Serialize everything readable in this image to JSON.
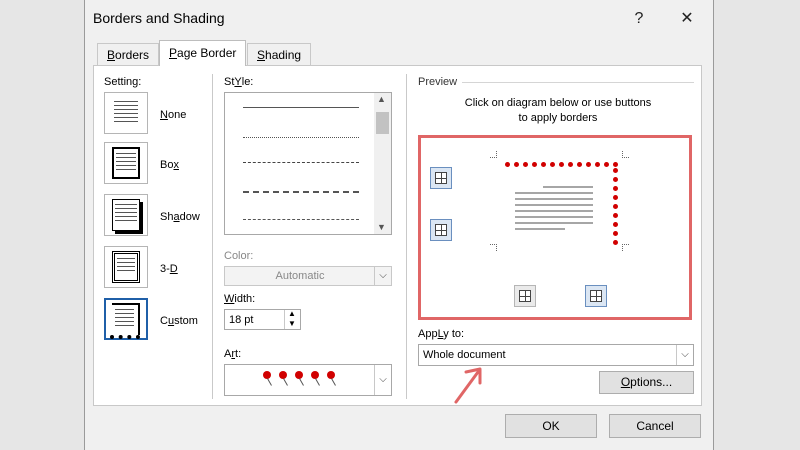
{
  "dialog": {
    "title": "Borders and Shading",
    "help": "?",
    "close": "✕"
  },
  "tabs": [
    {
      "label": "Borders",
      "mnemonic": "B",
      "rest": "orders"
    },
    {
      "label": "Page Border",
      "mnemonic": "P",
      "rest": "age Border"
    },
    {
      "label": "Shading",
      "mnemonic": "S",
      "rest": "hading"
    }
  ],
  "setting": {
    "label": "Setting:",
    "options": [
      {
        "mn": "N",
        "rest": "one"
      },
      {
        "mn": "x",
        "pre": "Bo"
      },
      {
        "mn": "a",
        "pre": "Sh",
        "rest": "dow"
      },
      {
        "pre": "3-",
        "mn": "D"
      },
      {
        "mn": "u",
        "pre": "C",
        "rest": "stom"
      }
    ]
  },
  "style": {
    "label_mn": "Y",
    "label_pre": "St",
    "label_rest": "le:"
  },
  "color": {
    "label": "Color:",
    "value": "Automatic"
  },
  "width": {
    "label_mn": "W",
    "label_rest": "idth:",
    "value": "18 pt"
  },
  "art": {
    "label_pre": "A",
    "label_mn": "r",
    "label_rest": "t:"
  },
  "preview": {
    "label": "Preview",
    "instruction_line1": "Click on diagram below or use buttons",
    "instruction_line2": "to apply borders"
  },
  "apply_to": {
    "label_mn": "L",
    "label_pre": "App",
    "label_rest": "y to:",
    "value": "Whole document"
  },
  "buttons": {
    "options_mn": "O",
    "options_rest": "ptions...",
    "ok": "OK",
    "cancel": "Cancel"
  },
  "colors": {
    "accent": "#1f5fa8",
    "highlight": "#e06666",
    "art_red": "#d10000"
  }
}
